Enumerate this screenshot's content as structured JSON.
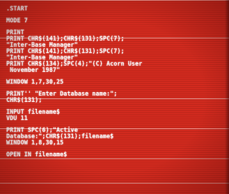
{
  "listing": {
    "start": ".START",
    "mode": "MODE 7",
    "block_print": [
      "PRINT",
      "PRINT CHR$(141);CHR$(131);SPC(7);",
      "\"Inter-Base Manager\"",
      "PRINT CHR$(141);CHR$(131);SPC(7);",
      "\"Inter-Base Manager\"",
      "PRINT CHR$(134);SPC(4);\"(C) Acorn User",
      " November 1987\""
    ],
    "window_1": "WINDOW 1,7,30,25",
    "block_prompt": [
      "PRINT'' \"Enter Database name:\";",
      "CHR$(131);"
    ],
    "block_input": [
      "INPUT filename$",
      "VDU 11"
    ],
    "block_active": [
      "PRINT SPC(6);\"Active",
      "Database:\";CHR$(131);filename$",
      "WINDOW 1,8,30,15"
    ],
    "open_line": "OPEN IN filename$"
  },
  "colors": {
    "background": "#d22a1e",
    "text": "#ffffff"
  }
}
